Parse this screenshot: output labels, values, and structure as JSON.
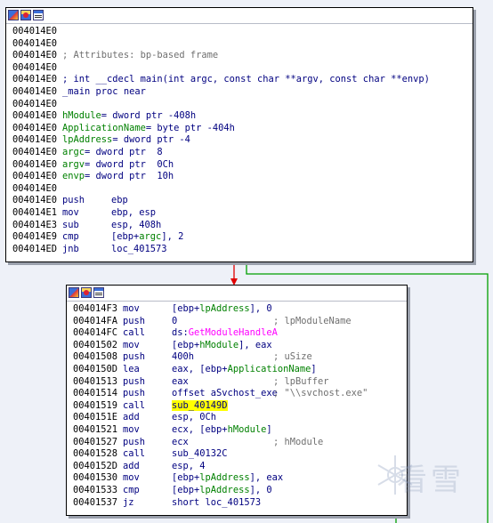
{
  "block1": {
    "lines": [
      {
        "addr": "004014E0"
      },
      {
        "addr": "004014E0"
      },
      {
        "addr": "004014E0",
        "comment": "; Attributes: bp-based frame"
      },
      {
        "addr": "004014E0"
      },
      {
        "addr": "004014E0",
        "text": "; int __cdecl main(int argc, const char **argv, const char **envp)"
      },
      {
        "addr": "004014E0",
        "text": "_main proc near"
      },
      {
        "addr": "004014E0"
      },
      {
        "addr": "004014E0",
        "var": "hModule",
        "text": "= dword ptr -408h"
      },
      {
        "addr": "004014E0",
        "var": "ApplicationName",
        "text": "= byte ptr -404h"
      },
      {
        "addr": "004014E0",
        "var": "lpAddress",
        "text": "= dword ptr -4"
      },
      {
        "addr": "004014E0",
        "var": "argc",
        "text": "= dword ptr  8"
      },
      {
        "addr": "004014E0",
        "var": "argv",
        "text": "= dword ptr  0Ch"
      },
      {
        "addr": "004014E0",
        "var": "envp",
        "text": "= dword ptr  10h"
      },
      {
        "addr": "004014E0"
      },
      {
        "addr": "004014E0",
        "mn": "push",
        "ops": "ebp"
      },
      {
        "addr": "004014E1",
        "mn": "mov",
        "ops": "ebp, esp"
      },
      {
        "addr": "004014E3",
        "mn": "sub",
        "ops": "esp, 408h"
      },
      {
        "addr": "004014E9",
        "mn": "cmp",
        "ops_pre": "[ebp+",
        "ops_name": "argc",
        "ops_post": "], 2"
      },
      {
        "addr": "004014ED",
        "mn": "jnb",
        "ops": "loc_401573"
      }
    ]
  },
  "block2": {
    "lines": [
      {
        "addr": "004014F3",
        "mn": "mov",
        "ops_pre": "[ebp+",
        "ops_name": "lpAddress",
        "ops_post": "], 0"
      },
      {
        "addr": "004014FA",
        "mn": "push",
        "ops": "0",
        "comment": "; lpModuleName"
      },
      {
        "addr": "004014FC",
        "mn": "call",
        "ops_pre": "ds:",
        "ops_imp": "GetModuleHandleA"
      },
      {
        "addr": "00401502",
        "mn": "mov",
        "ops_pre": "[ebp+",
        "ops_name": "hModule",
        "ops_post": "], eax"
      },
      {
        "addr": "00401508",
        "mn": "push",
        "ops": "400h",
        "comment": "; uSize"
      },
      {
        "addr": "0040150D",
        "mn": "lea",
        "ops_pre": "eax, [ebp+",
        "ops_name": "ApplicationName",
        "ops_post": "]"
      },
      {
        "addr": "00401513",
        "mn": "push",
        "ops": "eax",
        "comment": "; lpBuffer"
      },
      {
        "addr": "00401514",
        "mn": "push",
        "ops": "offset aSvchost_exe",
        "comment": "; \"\\\\svchost.exe\""
      },
      {
        "addr": "00401519",
        "mn": "call",
        "ops_hl": "sub_40149D"
      },
      {
        "addr": "0040151E",
        "mn": "add",
        "ops": "esp, 0Ch"
      },
      {
        "addr": "00401521",
        "mn": "mov",
        "ops_pre": "ecx, [ebp+",
        "ops_name": "hModule",
        "ops_post": "]"
      },
      {
        "addr": "00401527",
        "mn": "push",
        "ops": "ecx",
        "comment": "; hModule"
      },
      {
        "addr": "00401528",
        "mn": "call",
        "ops": "sub_40132C"
      },
      {
        "addr": "0040152D",
        "mn": "add",
        "ops": "esp, 4"
      },
      {
        "addr": "00401530",
        "mn": "mov",
        "ops_pre": "[ebp+",
        "ops_name": "lpAddress",
        "ops_post": "], eax"
      },
      {
        "addr": "00401533",
        "mn": "cmp",
        "ops_pre": "[ebp+",
        "ops_name": "lpAddress",
        "ops_post": "], 0"
      },
      {
        "addr": "00401537",
        "mn": "jz",
        "ops": "short loc_401573"
      }
    ]
  },
  "watermark": {
    "text": "看雪"
  },
  "colors": {
    "true_edge": "#00a000",
    "false_edge": "#e00000",
    "background": "#eef1f8"
  }
}
